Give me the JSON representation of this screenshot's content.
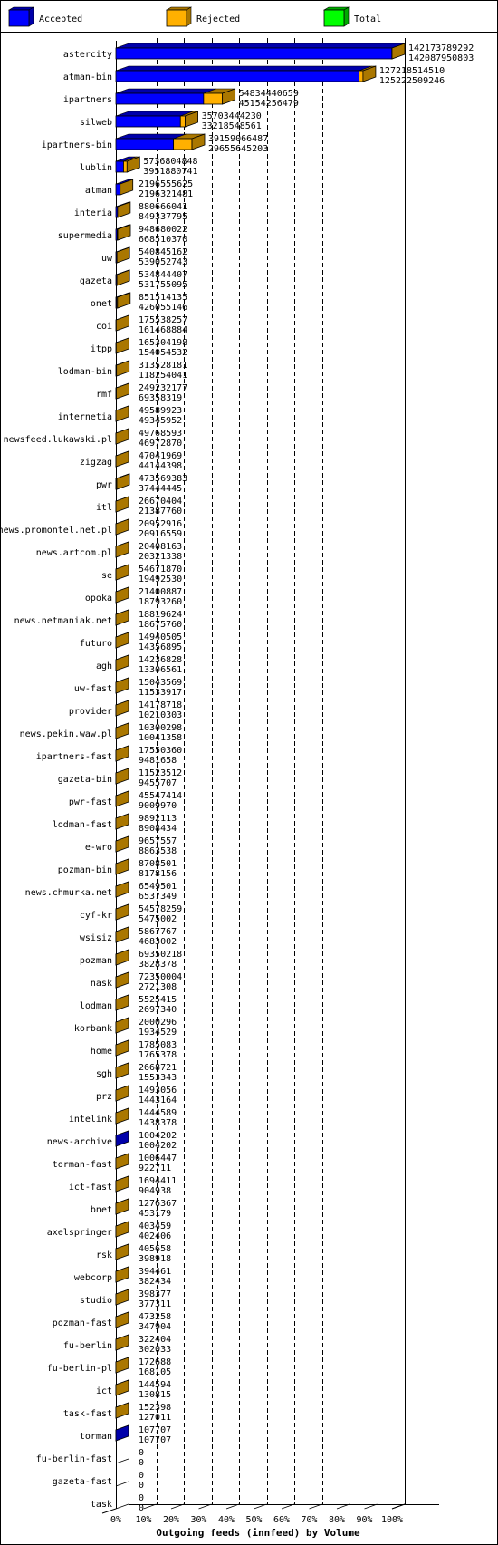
{
  "chart_data": {
    "type": "bar",
    "orientation": "horizontal",
    "stacked": true,
    "three_d": true,
    "title": "Outgoing feeds (innfeed) by Volume",
    "legend": {
      "placement": "top",
      "entries": [
        {
          "name": "Accepted",
          "color": "#0000ff",
          "shade": "#0000aa"
        },
        {
          "name": "Rejected",
          "color": "#ffb000",
          "shade": "#aa7700"
        },
        {
          "name": "Total",
          "color": "#00ff00",
          "shade": "#00aa00"
        }
      ]
    },
    "x_ticks": [
      "0%",
      "10%",
      "20%",
      "30%",
      "40%",
      "50%",
      "60%",
      "70%",
      "80%",
      "90%",
      "100%"
    ],
    "xlim": [
      0,
      100
    ],
    "grid": true,
    "categories": [
      "astercity",
      "atman-bin",
      "ipartners",
      "silweb",
      "ipartners-bin",
      "lublin",
      "atman",
      "interia",
      "supermedia",
      "uw",
      "gazeta",
      "onet",
      "coi",
      "itpp",
      "lodman-bin",
      "rmf",
      "internetia",
      "newsfeed.lukawski.pl",
      "zigzag",
      "pwr",
      "itl",
      "news.promontel.net.pl",
      "news.artcom.pl",
      "se",
      "opoka",
      "news.netmaniak.net",
      "futuro",
      "agh",
      "uw-fast",
      "provider",
      "news.pekin.waw.pl",
      "ipartners-fast",
      "gazeta-bin",
      "pwr-fast",
      "lodman-fast",
      "e-wro",
      "pozman-bin",
      "news.chmurka.net",
      "cyf-kr",
      "wsisiz",
      "pozman",
      "nask",
      "lodman",
      "korbank",
      "home",
      "sgh",
      "prz",
      "intelink",
      "news-archive",
      "torman-fast",
      "ict-fast",
      "bnet",
      "axelspringer",
      "rsk",
      "webcorp",
      "studio",
      "pozman-fast",
      "fu-berlin",
      "fu-berlin-pl",
      "ict",
      "task-fast",
      "torman",
      "fu-berlin-fast",
      "gazeta-fast",
      "task"
    ],
    "totals": [
      "142173789292",
      "127218514510",
      "54834440659",
      "35703444230",
      "39159066487",
      "5736804848",
      "2196555625",
      "880666041",
      "948680022",
      "540845162",
      "534844407",
      "851514135",
      "175538257",
      "165304198",
      "313528181",
      "249232177",
      "49589923",
      "49768593",
      "47041969",
      "473569383",
      "26670404",
      "20952916",
      "20408163",
      "54671870",
      "21400887",
      "18819624",
      "14940505",
      "14236828",
      "15043569",
      "14178718",
      "10300298",
      "17550360",
      "11523512",
      "45547414",
      "9892113",
      "9657557",
      "8708501",
      "6549501",
      "54578259",
      "5867767",
      "69350218",
      "72350004",
      "5525415",
      "2000296",
      "1785083",
      "2668721",
      "1493056",
      "1444589",
      "1004202",
      "1006447",
      "1694411",
      "1276367",
      "403459",
      "405658",
      "394461",
      "398377",
      "473258",
      "322404",
      "172688",
      "144594",
      "152398",
      "107707",
      "0",
      "0",
      "0"
    ],
    "accepted": [
      "142087950803",
      "125222509246",
      "45154256479",
      "33218548561",
      "29655645203",
      "3951880741",
      "2196321481",
      "849337795",
      "668510370",
      "539052743",
      "531755095",
      "426055146",
      "161468884",
      "154054532",
      "118254041",
      "69358319",
      "49345952",
      "46972870",
      "44144398",
      "37444445",
      "21387760",
      "20916559",
      "20321338",
      "19492530",
      "18793260",
      "18675760",
      "14356895",
      "13306561",
      "11533917",
      "10210303",
      "10041358",
      "9481658",
      "9455707",
      "9009970",
      "8908434",
      "8863538",
      "8178156",
      "6537349",
      "5475002",
      "4683002",
      "3828378",
      "2721308",
      "2697340",
      "1934529",
      "1765378",
      "1553343",
      "1443164",
      "1438378",
      "1004202",
      "922711",
      "904938",
      "453179",
      "402406",
      "398918",
      "382434",
      "377311",
      "347904",
      "302033",
      "168105",
      "130815",
      "127011",
      "107707",
      "0",
      "0",
      "0"
    ]
  }
}
